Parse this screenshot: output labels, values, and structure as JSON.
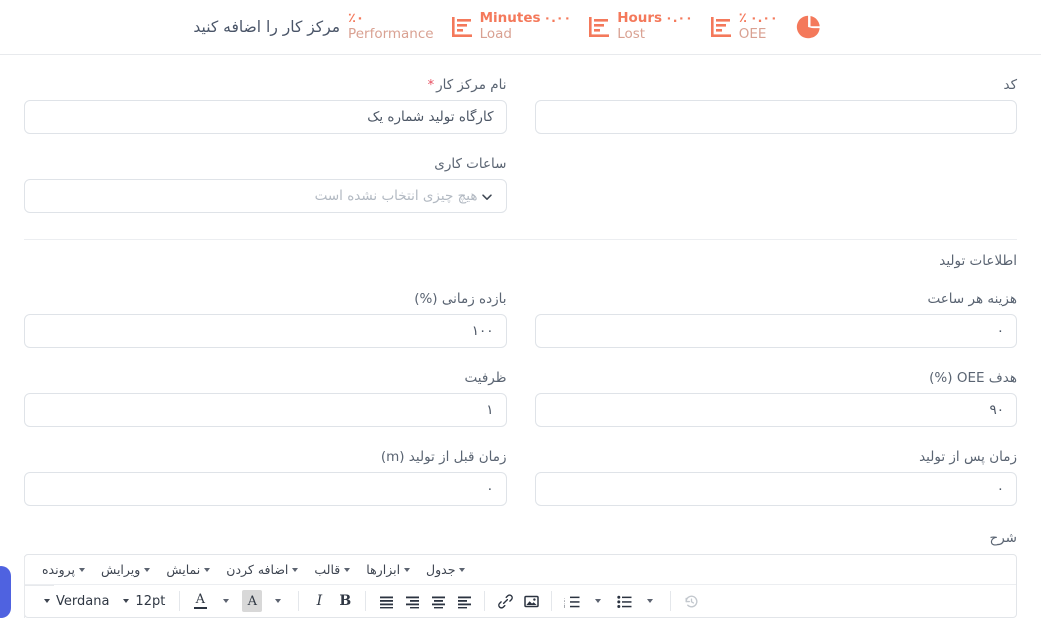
{
  "header": {
    "title": "مرکز کار را اضافه کنید",
    "kpis": [
      {
        "id": "performance",
        "value": "٪۰",
        "name": "",
        "label": "Performance",
        "icon": "percent-text-icon"
      },
      {
        "id": "load",
        "value": "۰.۰۰",
        "name": "Minutes",
        "label": "Load",
        "icon": "bar-chart-icon"
      },
      {
        "id": "lost",
        "value": "۰.۰۰",
        "name": "Hours",
        "label": "Lost",
        "icon": "bar-chart-icon"
      },
      {
        "id": "oee",
        "value": "۰.۰۰",
        "name": "٪",
        "label": "OEE",
        "icon": "bar-chart-icon"
      }
    ],
    "pie_icon": "pie-chart-icon"
  },
  "form": {
    "work_center_name": {
      "label": "نام مرکز کار",
      "required_mark": "*",
      "value": "کارگاه تولید شماره یک",
      "placeholder": ""
    },
    "code": {
      "label": "کد",
      "value": "",
      "placeholder": ""
    },
    "working_hours": {
      "label": "ساعات کاری",
      "placeholder": "هیچ چیزی انتخاب نشده است",
      "value": ""
    },
    "section_production": {
      "title": "اطلاعات تولید"
    },
    "time_efficiency": {
      "label": "بازده زمانی (%)",
      "value": "۱۰۰"
    },
    "cost_per_hour": {
      "label": "هزینه هر ساعت",
      "value": "۰"
    },
    "capacity": {
      "label": "ظرفیت",
      "value": "۱"
    },
    "oee_target": {
      "label": "هدف OEE (%)",
      "value": "۹۰"
    },
    "time_before_production": {
      "label": "زمان قبل از تولید (m)",
      "value": "۰"
    },
    "time_after_production": {
      "label": "زمان پس از تولید",
      "value": "۰"
    },
    "description": {
      "label": "شرح"
    }
  },
  "editor": {
    "menus": [
      {
        "label": "پرونده"
      },
      {
        "label": "ویرایش"
      },
      {
        "label": "نمایش"
      },
      {
        "label": "اضافه کردن"
      },
      {
        "label": "قالب"
      },
      {
        "label": "ابزارها"
      },
      {
        "label": "جدول"
      }
    ],
    "toolbar": {
      "font_family": "Verdana",
      "font_size": "12pt",
      "bold": "B",
      "italic": "I",
      "text_color_glyph": "A",
      "highlight_glyph": "A",
      "icons": {
        "align_left": "align-left-icon",
        "align_center": "align-center-icon",
        "align_right": "align-right-icon",
        "align_justify": "align-justify-icon",
        "bullet_list": "bullet-list-icon",
        "numbered_list": "numbered-list-icon",
        "image": "image-icon",
        "link": "link-icon",
        "history": "history-icon"
      }
    }
  },
  "colors": {
    "accent": "#f4795b",
    "accent_muted": "#d9a192",
    "label": "#5a6472",
    "border": "#dfe3e8",
    "required": "#e74c5e",
    "edge_tab": "#4f62e0"
  }
}
